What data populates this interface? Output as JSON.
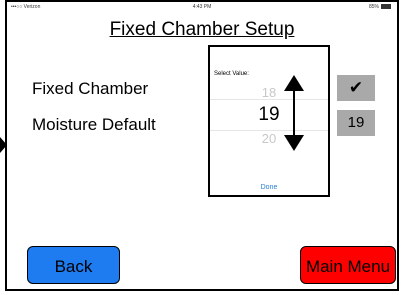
{
  "status_bar": {
    "carrier": "•••○○ Verizon",
    "time": "4:43 PM",
    "battery": "85%"
  },
  "title": "Fixed Chamber Setup",
  "rows": [
    {
      "label": "Fixed Chamber",
      "value": "✔"
    },
    {
      "label": "Moisture Default",
      "value": "19"
    }
  ],
  "picker": {
    "label": "Select Value:",
    "above": "18",
    "selected": "19",
    "below": "20",
    "done": "Done"
  },
  "buttons": {
    "back": "Back",
    "main_menu": "Main Menu"
  },
  "colors": {
    "back": "#1e7bf0",
    "main_menu": "#ff0000",
    "value_box": "#a9a9a9",
    "done_link": "#2a7dd6"
  }
}
